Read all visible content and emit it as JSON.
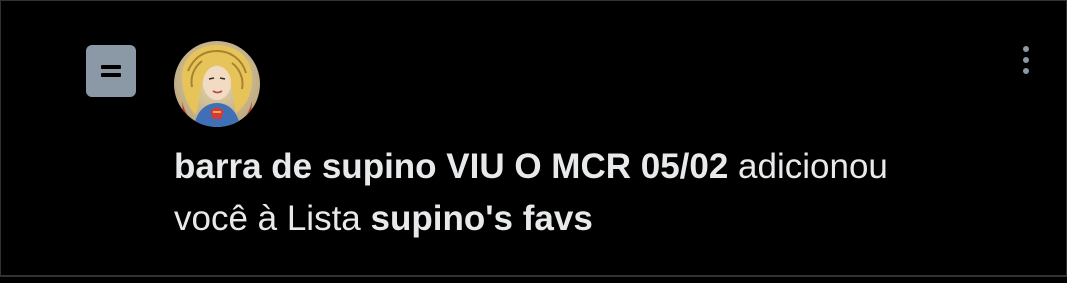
{
  "notification": {
    "type": "list-added",
    "icon": "list-icon",
    "actor_name": "barra de supino VIU O MCR 05/02",
    "action_text": "adicionou",
    "connector_text": "você à Lista",
    "list_name": "supino's favs",
    "more_icon": "more-vertical-icon"
  },
  "colors": {
    "background": "#000000",
    "border": "#2f3336",
    "text": "#e7e9ea",
    "muted": "#8b98a5"
  }
}
